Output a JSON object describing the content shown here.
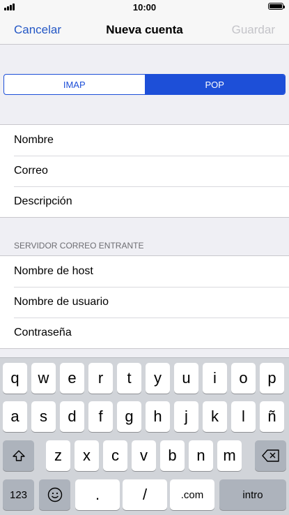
{
  "status": {
    "time": "10:00"
  },
  "nav": {
    "cancel": "Cancelar",
    "title": "Nueva cuenta",
    "save": "Guardar"
  },
  "segment": {
    "options": [
      "IMAP",
      "POP"
    ],
    "selected": "POP"
  },
  "account_fields": [
    "Nombre",
    "Correo",
    "Descripción"
  ],
  "incoming": {
    "header": "SERVIDOR CORREO ENTRANTE",
    "fields": [
      "Nombre de host",
      "Nombre de usuario",
      "Contraseña"
    ]
  },
  "keyboard": {
    "row1": [
      "q",
      "w",
      "e",
      "r",
      "t",
      "y",
      "u",
      "i",
      "o",
      "p"
    ],
    "row2": [
      "a",
      "s",
      "d",
      "f",
      "g",
      "h",
      "j",
      "k",
      "l",
      "ñ"
    ],
    "row3": [
      "z",
      "x",
      "c",
      "v",
      "b",
      "n",
      "m"
    ],
    "bottom": {
      "numbers": "123",
      "period": ".",
      "slash": "/",
      "dotcom": ".com",
      "enter": "intro"
    },
    "icons": {
      "shift": "shift-icon",
      "delete": "delete-icon",
      "emoji": "emoji-icon"
    }
  }
}
